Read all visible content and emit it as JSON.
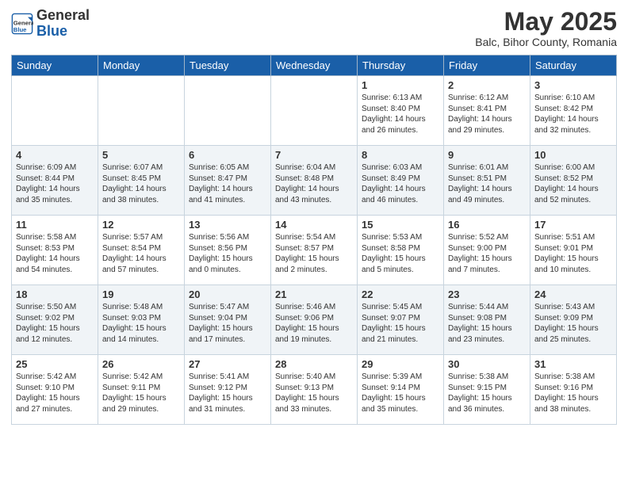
{
  "header": {
    "logo_general": "General",
    "logo_blue": "Blue",
    "month_title": "May 2025",
    "location": "Balc, Bihor County, Romania"
  },
  "days_of_week": [
    "Sunday",
    "Monday",
    "Tuesday",
    "Wednesday",
    "Thursday",
    "Friday",
    "Saturday"
  ],
  "weeks": [
    [
      {
        "day": "",
        "info": ""
      },
      {
        "day": "",
        "info": ""
      },
      {
        "day": "",
        "info": ""
      },
      {
        "day": "",
        "info": ""
      },
      {
        "day": "1",
        "info": "Sunrise: 6:13 AM\nSunset: 8:40 PM\nDaylight: 14 hours\nand 26 minutes."
      },
      {
        "day": "2",
        "info": "Sunrise: 6:12 AM\nSunset: 8:41 PM\nDaylight: 14 hours\nand 29 minutes."
      },
      {
        "day": "3",
        "info": "Sunrise: 6:10 AM\nSunset: 8:42 PM\nDaylight: 14 hours\nand 32 minutes."
      }
    ],
    [
      {
        "day": "4",
        "info": "Sunrise: 6:09 AM\nSunset: 8:44 PM\nDaylight: 14 hours\nand 35 minutes."
      },
      {
        "day": "5",
        "info": "Sunrise: 6:07 AM\nSunset: 8:45 PM\nDaylight: 14 hours\nand 38 minutes."
      },
      {
        "day": "6",
        "info": "Sunrise: 6:05 AM\nSunset: 8:47 PM\nDaylight: 14 hours\nand 41 minutes."
      },
      {
        "day": "7",
        "info": "Sunrise: 6:04 AM\nSunset: 8:48 PM\nDaylight: 14 hours\nand 43 minutes."
      },
      {
        "day": "8",
        "info": "Sunrise: 6:03 AM\nSunset: 8:49 PM\nDaylight: 14 hours\nand 46 minutes."
      },
      {
        "day": "9",
        "info": "Sunrise: 6:01 AM\nSunset: 8:51 PM\nDaylight: 14 hours\nand 49 minutes."
      },
      {
        "day": "10",
        "info": "Sunrise: 6:00 AM\nSunset: 8:52 PM\nDaylight: 14 hours\nand 52 minutes."
      }
    ],
    [
      {
        "day": "11",
        "info": "Sunrise: 5:58 AM\nSunset: 8:53 PM\nDaylight: 14 hours\nand 54 minutes."
      },
      {
        "day": "12",
        "info": "Sunrise: 5:57 AM\nSunset: 8:54 PM\nDaylight: 14 hours\nand 57 minutes."
      },
      {
        "day": "13",
        "info": "Sunrise: 5:56 AM\nSunset: 8:56 PM\nDaylight: 15 hours\nand 0 minutes."
      },
      {
        "day": "14",
        "info": "Sunrise: 5:54 AM\nSunset: 8:57 PM\nDaylight: 15 hours\nand 2 minutes."
      },
      {
        "day": "15",
        "info": "Sunrise: 5:53 AM\nSunset: 8:58 PM\nDaylight: 15 hours\nand 5 minutes."
      },
      {
        "day": "16",
        "info": "Sunrise: 5:52 AM\nSunset: 9:00 PM\nDaylight: 15 hours\nand 7 minutes."
      },
      {
        "day": "17",
        "info": "Sunrise: 5:51 AM\nSunset: 9:01 PM\nDaylight: 15 hours\nand 10 minutes."
      }
    ],
    [
      {
        "day": "18",
        "info": "Sunrise: 5:50 AM\nSunset: 9:02 PM\nDaylight: 15 hours\nand 12 minutes."
      },
      {
        "day": "19",
        "info": "Sunrise: 5:48 AM\nSunset: 9:03 PM\nDaylight: 15 hours\nand 14 minutes."
      },
      {
        "day": "20",
        "info": "Sunrise: 5:47 AM\nSunset: 9:04 PM\nDaylight: 15 hours\nand 17 minutes."
      },
      {
        "day": "21",
        "info": "Sunrise: 5:46 AM\nSunset: 9:06 PM\nDaylight: 15 hours\nand 19 minutes."
      },
      {
        "day": "22",
        "info": "Sunrise: 5:45 AM\nSunset: 9:07 PM\nDaylight: 15 hours\nand 21 minutes."
      },
      {
        "day": "23",
        "info": "Sunrise: 5:44 AM\nSunset: 9:08 PM\nDaylight: 15 hours\nand 23 minutes."
      },
      {
        "day": "24",
        "info": "Sunrise: 5:43 AM\nSunset: 9:09 PM\nDaylight: 15 hours\nand 25 minutes."
      }
    ],
    [
      {
        "day": "25",
        "info": "Sunrise: 5:42 AM\nSunset: 9:10 PM\nDaylight: 15 hours\nand 27 minutes."
      },
      {
        "day": "26",
        "info": "Sunrise: 5:42 AM\nSunset: 9:11 PM\nDaylight: 15 hours\nand 29 minutes."
      },
      {
        "day": "27",
        "info": "Sunrise: 5:41 AM\nSunset: 9:12 PM\nDaylight: 15 hours\nand 31 minutes."
      },
      {
        "day": "28",
        "info": "Sunrise: 5:40 AM\nSunset: 9:13 PM\nDaylight: 15 hours\nand 33 minutes."
      },
      {
        "day": "29",
        "info": "Sunrise: 5:39 AM\nSunset: 9:14 PM\nDaylight: 15 hours\nand 35 minutes."
      },
      {
        "day": "30",
        "info": "Sunrise: 5:38 AM\nSunset: 9:15 PM\nDaylight: 15 hours\nand 36 minutes."
      },
      {
        "day": "31",
        "info": "Sunrise: 5:38 AM\nSunset: 9:16 PM\nDaylight: 15 hours\nand 38 minutes."
      }
    ]
  ]
}
